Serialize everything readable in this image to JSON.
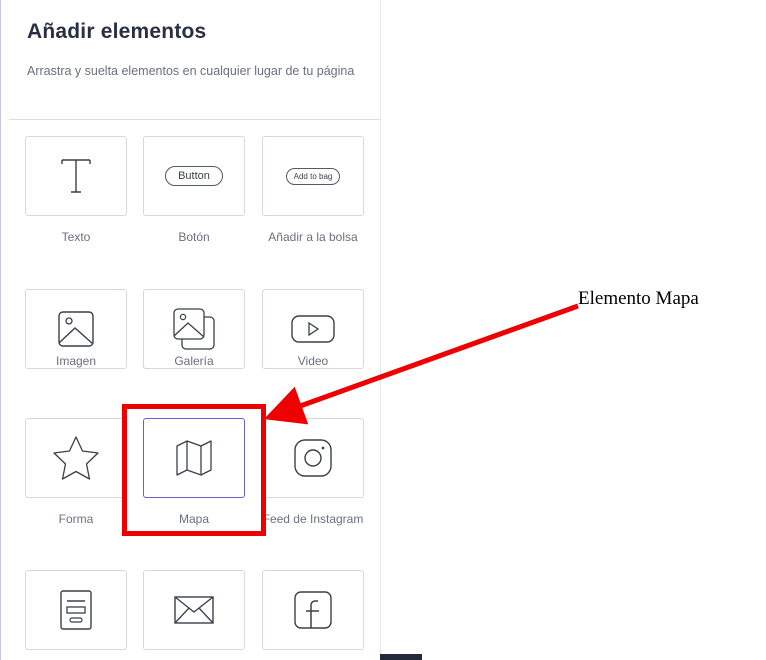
{
  "panel": {
    "title": "Añadir elementos",
    "subtitle": "Arrastra y suelta elementos en cualquier lugar de tu página"
  },
  "elements": [
    {
      "label": "Texto",
      "icon": "text-t-icon"
    },
    {
      "label": "Botón",
      "icon": "button-icon",
      "preview_text": "Button"
    },
    {
      "label": "Añadir a la bolsa",
      "icon": "add-to-bag-icon",
      "preview_text": "Add to bag"
    },
    {
      "label": "Imagen",
      "icon": "image-icon"
    },
    {
      "label": "Galería",
      "icon": "gallery-icon"
    },
    {
      "label": "Video",
      "icon": "video-icon"
    },
    {
      "label": "Forma",
      "icon": "star-icon"
    },
    {
      "label": "Mapa",
      "icon": "map-icon",
      "selected": true
    },
    {
      "label": "Feed de Instagram",
      "icon": "instagram-icon"
    },
    {
      "label": "",
      "icon": "form-icon"
    },
    {
      "label": "",
      "icon": "mail-icon"
    },
    {
      "label": "",
      "icon": "facebook-icon"
    }
  ],
  "annotation": {
    "callout_text": "Elemento Mapa",
    "highlight_color": "#ee0000"
  },
  "colors": {
    "selected_border": "#6a5fd2",
    "title": "#2a2f45",
    "muted_text": "#6b6f7e"
  }
}
